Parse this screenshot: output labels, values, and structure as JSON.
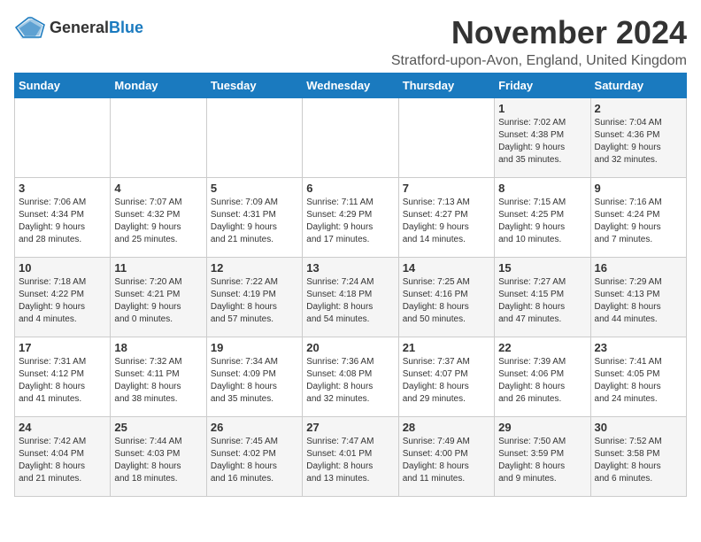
{
  "logo": {
    "text_general": "General",
    "text_blue": "Blue"
  },
  "title": "November 2024",
  "location": "Stratford-upon-Avon, England, United Kingdom",
  "weekdays": [
    "Sunday",
    "Monday",
    "Tuesday",
    "Wednesday",
    "Thursday",
    "Friday",
    "Saturday"
  ],
  "weeks": [
    [
      {
        "day": "",
        "info": ""
      },
      {
        "day": "",
        "info": ""
      },
      {
        "day": "",
        "info": ""
      },
      {
        "day": "",
        "info": ""
      },
      {
        "day": "",
        "info": ""
      },
      {
        "day": "1",
        "info": "Sunrise: 7:02 AM\nSunset: 4:38 PM\nDaylight: 9 hours\nand 35 minutes."
      },
      {
        "day": "2",
        "info": "Sunrise: 7:04 AM\nSunset: 4:36 PM\nDaylight: 9 hours\nand 32 minutes."
      }
    ],
    [
      {
        "day": "3",
        "info": "Sunrise: 7:06 AM\nSunset: 4:34 PM\nDaylight: 9 hours\nand 28 minutes."
      },
      {
        "day": "4",
        "info": "Sunrise: 7:07 AM\nSunset: 4:32 PM\nDaylight: 9 hours\nand 25 minutes."
      },
      {
        "day": "5",
        "info": "Sunrise: 7:09 AM\nSunset: 4:31 PM\nDaylight: 9 hours\nand 21 minutes."
      },
      {
        "day": "6",
        "info": "Sunrise: 7:11 AM\nSunset: 4:29 PM\nDaylight: 9 hours\nand 17 minutes."
      },
      {
        "day": "7",
        "info": "Sunrise: 7:13 AM\nSunset: 4:27 PM\nDaylight: 9 hours\nand 14 minutes."
      },
      {
        "day": "8",
        "info": "Sunrise: 7:15 AM\nSunset: 4:25 PM\nDaylight: 9 hours\nand 10 minutes."
      },
      {
        "day": "9",
        "info": "Sunrise: 7:16 AM\nSunset: 4:24 PM\nDaylight: 9 hours\nand 7 minutes."
      }
    ],
    [
      {
        "day": "10",
        "info": "Sunrise: 7:18 AM\nSunset: 4:22 PM\nDaylight: 9 hours\nand 4 minutes."
      },
      {
        "day": "11",
        "info": "Sunrise: 7:20 AM\nSunset: 4:21 PM\nDaylight: 9 hours\nand 0 minutes."
      },
      {
        "day": "12",
        "info": "Sunrise: 7:22 AM\nSunset: 4:19 PM\nDaylight: 8 hours\nand 57 minutes."
      },
      {
        "day": "13",
        "info": "Sunrise: 7:24 AM\nSunset: 4:18 PM\nDaylight: 8 hours\nand 54 minutes."
      },
      {
        "day": "14",
        "info": "Sunrise: 7:25 AM\nSunset: 4:16 PM\nDaylight: 8 hours\nand 50 minutes."
      },
      {
        "day": "15",
        "info": "Sunrise: 7:27 AM\nSunset: 4:15 PM\nDaylight: 8 hours\nand 47 minutes."
      },
      {
        "day": "16",
        "info": "Sunrise: 7:29 AM\nSunset: 4:13 PM\nDaylight: 8 hours\nand 44 minutes."
      }
    ],
    [
      {
        "day": "17",
        "info": "Sunrise: 7:31 AM\nSunset: 4:12 PM\nDaylight: 8 hours\nand 41 minutes."
      },
      {
        "day": "18",
        "info": "Sunrise: 7:32 AM\nSunset: 4:11 PM\nDaylight: 8 hours\nand 38 minutes."
      },
      {
        "day": "19",
        "info": "Sunrise: 7:34 AM\nSunset: 4:09 PM\nDaylight: 8 hours\nand 35 minutes."
      },
      {
        "day": "20",
        "info": "Sunrise: 7:36 AM\nSunset: 4:08 PM\nDaylight: 8 hours\nand 32 minutes."
      },
      {
        "day": "21",
        "info": "Sunrise: 7:37 AM\nSunset: 4:07 PM\nDaylight: 8 hours\nand 29 minutes."
      },
      {
        "day": "22",
        "info": "Sunrise: 7:39 AM\nSunset: 4:06 PM\nDaylight: 8 hours\nand 26 minutes."
      },
      {
        "day": "23",
        "info": "Sunrise: 7:41 AM\nSunset: 4:05 PM\nDaylight: 8 hours\nand 24 minutes."
      }
    ],
    [
      {
        "day": "24",
        "info": "Sunrise: 7:42 AM\nSunset: 4:04 PM\nDaylight: 8 hours\nand 21 minutes."
      },
      {
        "day": "25",
        "info": "Sunrise: 7:44 AM\nSunset: 4:03 PM\nDaylight: 8 hours\nand 18 minutes."
      },
      {
        "day": "26",
        "info": "Sunrise: 7:45 AM\nSunset: 4:02 PM\nDaylight: 8 hours\nand 16 minutes."
      },
      {
        "day": "27",
        "info": "Sunrise: 7:47 AM\nSunset: 4:01 PM\nDaylight: 8 hours\nand 13 minutes."
      },
      {
        "day": "28",
        "info": "Sunrise: 7:49 AM\nSunset: 4:00 PM\nDaylight: 8 hours\nand 11 minutes."
      },
      {
        "day": "29",
        "info": "Sunrise: 7:50 AM\nSunset: 3:59 PM\nDaylight: 8 hours\nand 9 minutes."
      },
      {
        "day": "30",
        "info": "Sunrise: 7:52 AM\nSunset: 3:58 PM\nDaylight: 8 hours\nand 6 minutes."
      }
    ]
  ]
}
